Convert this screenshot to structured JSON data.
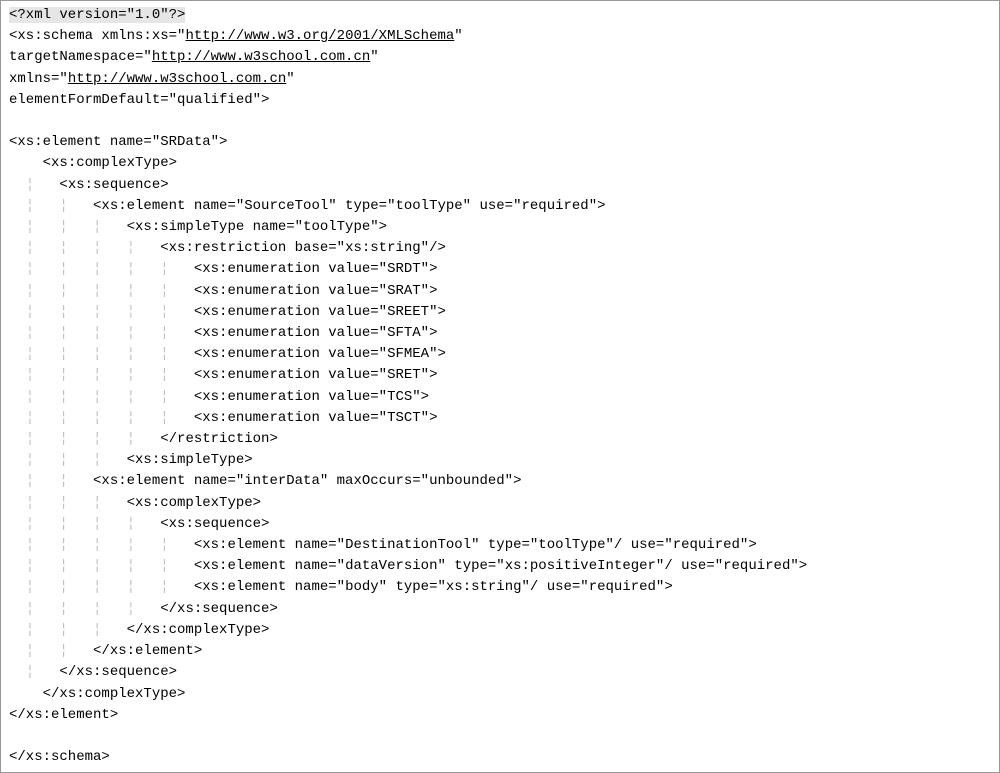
{
  "urls": {
    "xmlns_xs": "http://www.w3.org/2001/XMLSchema",
    "targetNamespace": "http://www.w3school.com.cn",
    "xmlns": "http://www.w3school.com.cn"
  },
  "l": {
    "0": "<?xml version=\"1.0\"?>",
    "1a": "<xs:schema xmlns:xs=\"",
    "1b": "\"",
    "2a": "targetNamespace=\"",
    "2b": "\"",
    "3a": "xmlns=\"",
    "3b": "\"",
    "4": "elementFormDefault=\"qualified\">",
    "5": "",
    "6": "<xs:element name=\"SRData\">",
    "7": "<xs:complexType>",
    "8": "<xs:sequence>",
    "9": "<xs:element name=\"SourceTool\" type=\"toolType\" use=\"required\">",
    "10": "<xs:simpleType name=\"toolType\">",
    "11": "<xs:restriction base=\"xs:string\"/>",
    "12": "<xs:enumeration value=\"SRDT\">",
    "13": "<xs:enumeration value=\"SRAT\">",
    "14": "<xs:enumeration value=\"SREET\">",
    "15": "<xs:enumeration value=\"SFTA\">",
    "16": "<xs:enumeration value=\"SFMEA\">",
    "17": "<xs:enumeration value=\"SRET\">",
    "18": "<xs:enumeration value=\"TCS\">",
    "19": "<xs:enumeration value=\"TSCT\">",
    "20": "</restriction>",
    "21": "<xs:simpleType>",
    "22": "<xs:element name=\"interData\" maxOccurs=\"unbounded\">",
    "23": "<xs:complexType>",
    "24": "<xs:sequence>",
    "25": "<xs:element name=\"DestinationTool\" type=\"toolType\"/ use=\"required\">",
    "26": "<xs:element name=\"dataVersion\" type=\"xs:positiveInteger\"/ use=\"required\">",
    "27": "<xs:element name=\"body\" type=\"xs:string\"/ use=\"required\">",
    "28": "</xs:sequence>",
    "29": "</xs:complexType>",
    "30": "</xs:element>",
    "31": "</xs:sequence>",
    "32": "</xs:complexType>",
    "33": "</xs:element>",
    "34": "",
    "35": "</xs:schema>"
  },
  "ind": {
    "i1": "    ",
    "i2": "  ¦   ",
    "i3": "  ¦   ¦   ",
    "i4": "  ¦   ¦   ¦   ",
    "i5": "  ¦   ¦   ¦   ¦   ",
    "i6": "  ¦   ¦   ¦   ¦   ¦   "
  }
}
